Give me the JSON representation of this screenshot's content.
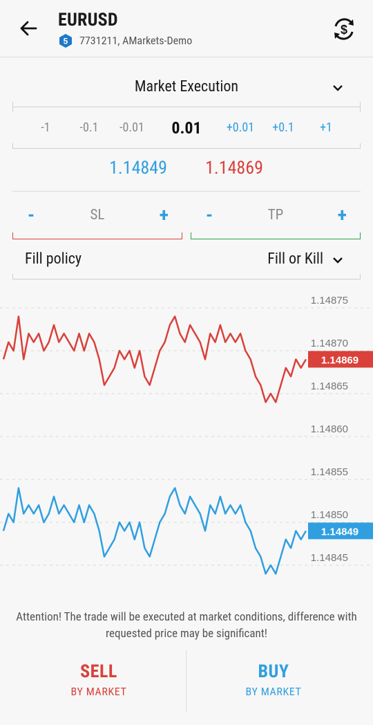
{
  "header": {
    "symbol": "EURUSD",
    "account_badge": "5",
    "account": "7731211, AMarkets-Demo"
  },
  "order": {
    "execution_type": "Market Execution",
    "volume_steps": [
      "-1",
      "-0.1",
      "-0.01",
      "0.01",
      "+0.01",
      "+0.1",
      "+1"
    ],
    "current_volume": "0.01",
    "bid": "1.14849",
    "ask": "1.14869",
    "sl_label": "SL",
    "tp_label": "TP",
    "minus": "-",
    "plus": "+",
    "fill_policy_label": "Fill policy",
    "fill_policy_value": "Fill or Kill"
  },
  "chart_data": {
    "type": "line",
    "y_ticks": [
      "1.14875",
      "1.14870",
      "1.14865",
      "1.14860",
      "1.14855",
      "1.14850",
      "1.14845"
    ],
    "ylim": [
      1.14845,
      1.14875
    ],
    "grid": true,
    "series": [
      {
        "color": "#d9413a",
        "current_label": "1.14869",
        "values": [
          1.14869,
          1.14871,
          1.1487,
          1.14874,
          1.14869,
          1.14872,
          1.14871,
          1.14872,
          1.1487,
          1.14871,
          1.14873,
          1.14871,
          1.14872,
          1.14871,
          1.1487,
          1.14872,
          1.1487,
          1.14872,
          1.14871,
          1.14869,
          1.14866,
          1.14867,
          1.14868,
          1.1487,
          1.14869,
          1.1487,
          1.14868,
          1.1487,
          1.14867,
          1.14866,
          1.14868,
          1.1487,
          1.14871,
          1.14873,
          1.14874,
          1.14872,
          1.14871,
          1.14873,
          1.14872,
          1.14871,
          1.14869,
          1.14872,
          1.14871,
          1.14873,
          1.14871,
          1.14872,
          1.14871,
          1.14872,
          1.1487,
          1.14869,
          1.14867,
          1.14866,
          1.14864,
          1.14865,
          1.14864,
          1.14866,
          1.14868,
          1.14867,
          1.14869,
          1.14868,
          1.14869
        ]
      },
      {
        "color": "#2f9fe0",
        "current_label": "1.14849",
        "values": [
          1.14849,
          1.14851,
          1.1485,
          1.14854,
          1.14851,
          1.14852,
          1.14851,
          1.14852,
          1.1485,
          1.14851,
          1.14853,
          1.14851,
          1.14852,
          1.14851,
          1.1485,
          1.14852,
          1.1485,
          1.14852,
          1.14851,
          1.14849,
          1.14846,
          1.14847,
          1.14848,
          1.1485,
          1.14849,
          1.1485,
          1.14848,
          1.1485,
          1.14847,
          1.14846,
          1.14848,
          1.1485,
          1.14851,
          1.14853,
          1.14854,
          1.14852,
          1.14851,
          1.14853,
          1.14852,
          1.14851,
          1.14849,
          1.14852,
          1.14851,
          1.14853,
          1.14851,
          1.14852,
          1.14851,
          1.14852,
          1.1485,
          1.14849,
          1.14847,
          1.14846,
          1.14844,
          1.14845,
          1.14844,
          1.14846,
          1.14848,
          1.14847,
          1.14849,
          1.14848,
          1.14849
        ]
      }
    ]
  },
  "notice": "Attention! The trade will be executed at market conditions, difference with requested price may be significant!",
  "actions": {
    "sell": "SELL",
    "sell_sub": "BY MARKET",
    "buy": "BUY",
    "buy_sub": "BY MARKET"
  },
  "colors": {
    "sell": "#d9413a",
    "buy": "#2f9fe0",
    "tp_underline": "#2aa14a",
    "badge": "#1e78c8"
  },
  "icons": [
    "back-arrow-icon",
    "account-hexagon-icon",
    "currency-sync-icon",
    "chevron-down-icon"
  ]
}
